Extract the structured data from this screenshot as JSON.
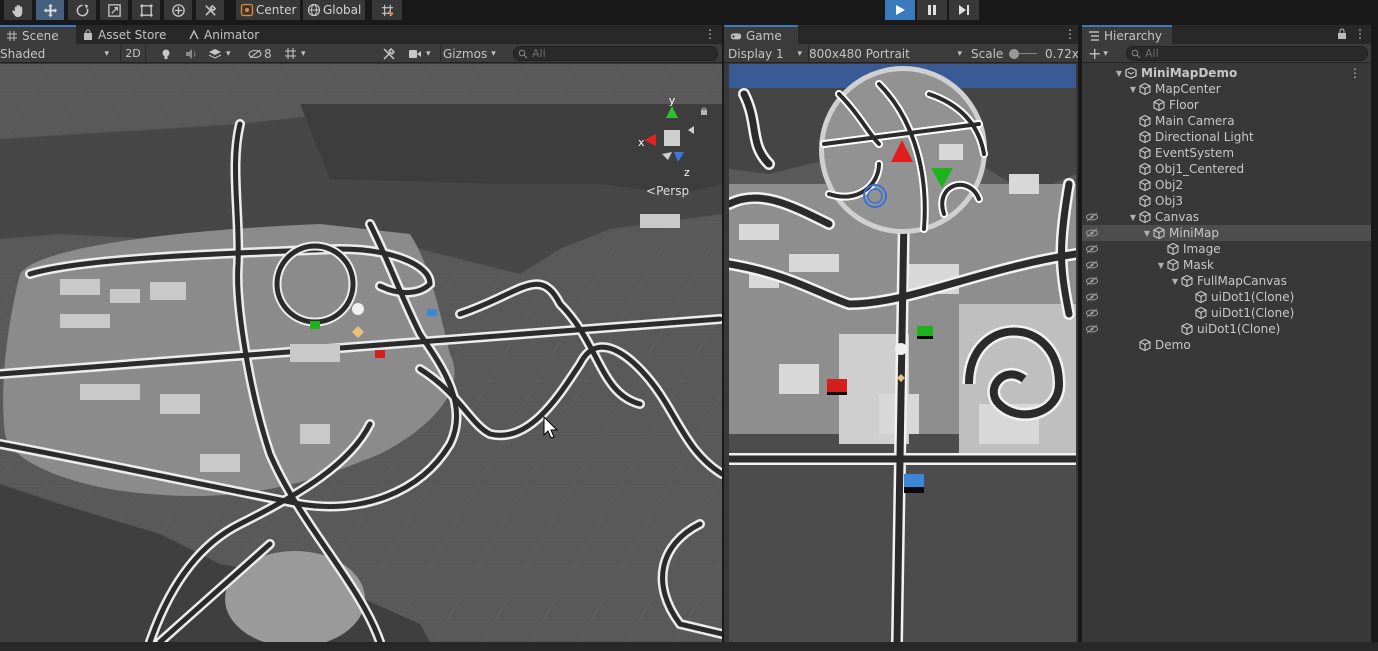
{
  "toolbar": {
    "tools": [
      "hand-tool",
      "move-tool",
      "rotate-tool",
      "scale-tool",
      "rect-tool",
      "transform-tool",
      "custom-tool"
    ],
    "pivot_label": "Center",
    "space_label": "Global",
    "play_active": true
  },
  "scene": {
    "tabs": [
      "Scene",
      "Asset Store",
      "Animator"
    ],
    "shading_mode": "Shaded",
    "mode_2d": "2D",
    "hidden_count": "8",
    "gizmos_label": "Gizmos",
    "search_placeholder": "All",
    "gizmo_axes": {
      "y": "y",
      "x": "x",
      "z": "z"
    },
    "persp_label": "Persp"
  },
  "game": {
    "tab": "Game",
    "display": "Display 1",
    "resolution": "800x480 Portrait",
    "scale_label": "Scale",
    "scale_value": "0.72x"
  },
  "hierarchy": {
    "tab": "Hierarchy",
    "search_placeholder": "All",
    "items": [
      {
        "label": "MiniMapDemo",
        "depth": 0,
        "arrow": "▼",
        "root": true
      },
      {
        "label": "MapCenter",
        "depth": 1,
        "arrow": "▼"
      },
      {
        "label": "Floor",
        "depth": 2,
        "arrow": ""
      },
      {
        "label": "Main Camera",
        "depth": 1,
        "arrow": ""
      },
      {
        "label": "Directional Light",
        "depth": 1,
        "arrow": ""
      },
      {
        "label": "EventSystem",
        "depth": 1,
        "arrow": ""
      },
      {
        "label": "Obj1_Centered",
        "depth": 1,
        "arrow": ""
      },
      {
        "label": "Obj2",
        "depth": 1,
        "arrow": ""
      },
      {
        "label": "Obj3",
        "depth": 1,
        "arrow": ""
      },
      {
        "label": "Canvas",
        "depth": 1,
        "arrow": "▼",
        "eye": true
      },
      {
        "label": "MiniMap",
        "depth": 2,
        "arrow": "▼",
        "eye": true,
        "selected": true
      },
      {
        "label": "Image",
        "depth": 3,
        "arrow": "",
        "eye": true
      },
      {
        "label": "Mask",
        "depth": 3,
        "arrow": "▼",
        "eye": true
      },
      {
        "label": "FullMapCanvas",
        "depth": 4,
        "arrow": "▼",
        "eye": true
      },
      {
        "label": "uiDot1(Clone)",
        "depth": 5,
        "arrow": "",
        "eye": true
      },
      {
        "label": "uiDot1(Clone)",
        "depth": 5,
        "arrow": "",
        "eye": true
      },
      {
        "label": "uiDot1(Clone)",
        "depth": 4,
        "arrow": "",
        "eye": true
      },
      {
        "label": "Demo",
        "depth": 1,
        "arrow": ""
      }
    ]
  },
  "colors": {
    "accent": "#3a79bb",
    "panel": "#383838",
    "ground": "#565656",
    "road": "#2b2b2b",
    "building": "#a9a9a9",
    "obj_green": "#1db31d",
    "obj_red": "#d41f1f",
    "obj_blue": "#3b86d6"
  }
}
